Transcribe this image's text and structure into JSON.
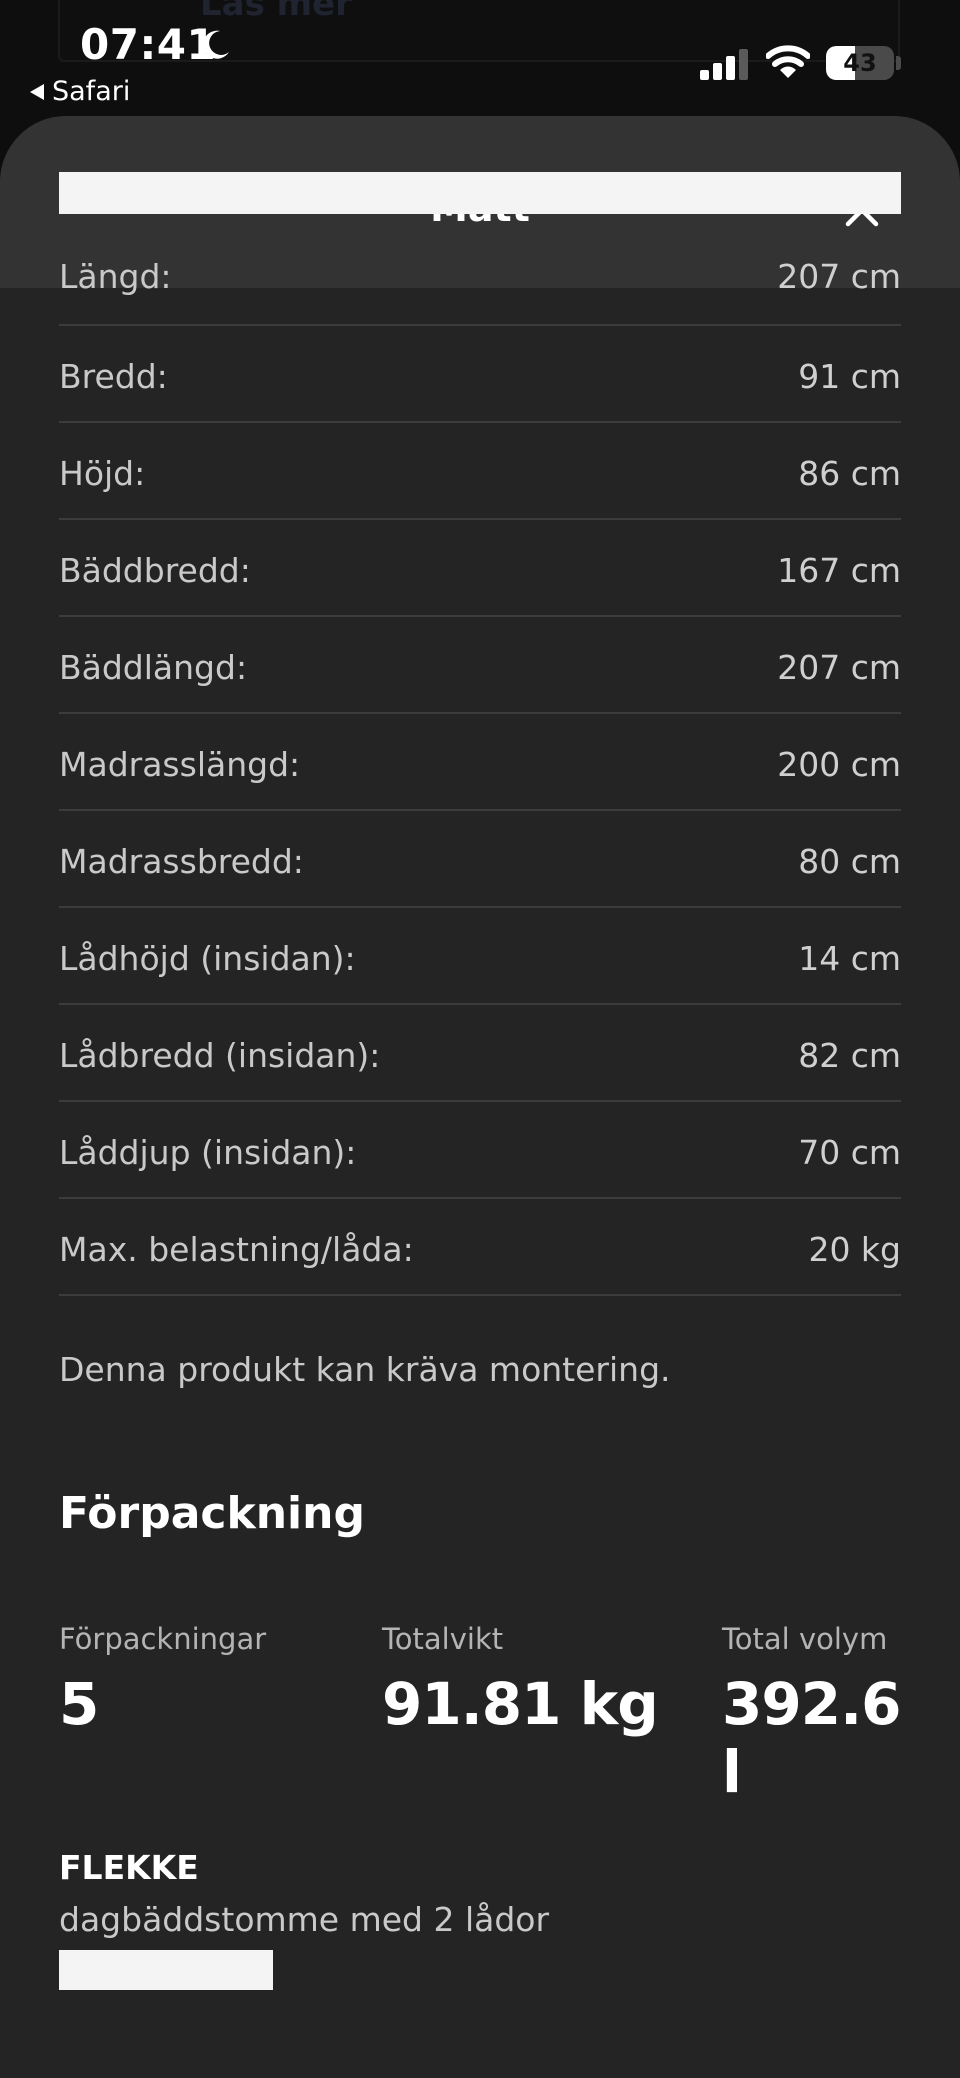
{
  "background_page": {
    "button_label": "Läs mer"
  },
  "status_bar": {
    "time": "07:41",
    "back_label": "Safari",
    "battery_level": "43",
    "battery_fraction": 0.43,
    "signal_bars_active": 3,
    "signal_bars_total": 4
  },
  "sheet": {
    "title": "Mått",
    "close_icon": "close-icon"
  },
  "dimensions": [
    {
      "label": "Längd:",
      "value": "207 cm"
    },
    {
      "label": "Bredd:",
      "value": "91 cm"
    },
    {
      "label": "Höjd:",
      "value": "86 cm"
    },
    {
      "label": "Bäddbredd:",
      "value": "167 cm"
    },
    {
      "label": "Bäddlängd:",
      "value": "207 cm"
    },
    {
      "label": "Madrasslängd:",
      "value": "200 cm"
    },
    {
      "label": "Madrassbredd:",
      "value": "80 cm"
    },
    {
      "label": "Lådhöjd (insidan):",
      "value": "14 cm"
    },
    {
      "label": "Lådbredd (insidan):",
      "value": "82 cm"
    },
    {
      "label": "Låddjup (insidan):",
      "value": "70 cm"
    },
    {
      "label": "Max. belastning/låda:",
      "value": "20 kg"
    }
  ],
  "assembly_note": "Denna produkt kan kräva montering.",
  "packaging": {
    "heading": "Förpackning",
    "stats": [
      {
        "label": "Förpackningar",
        "value": "5"
      },
      {
        "label": "Totalvikt",
        "value": "91.81 kg"
      },
      {
        "label": "Total volym",
        "value": "392.6 l"
      }
    ],
    "product_name": "FLEKKE",
    "product_desc": "dagbäddstomme med 2 lådor"
  }
}
